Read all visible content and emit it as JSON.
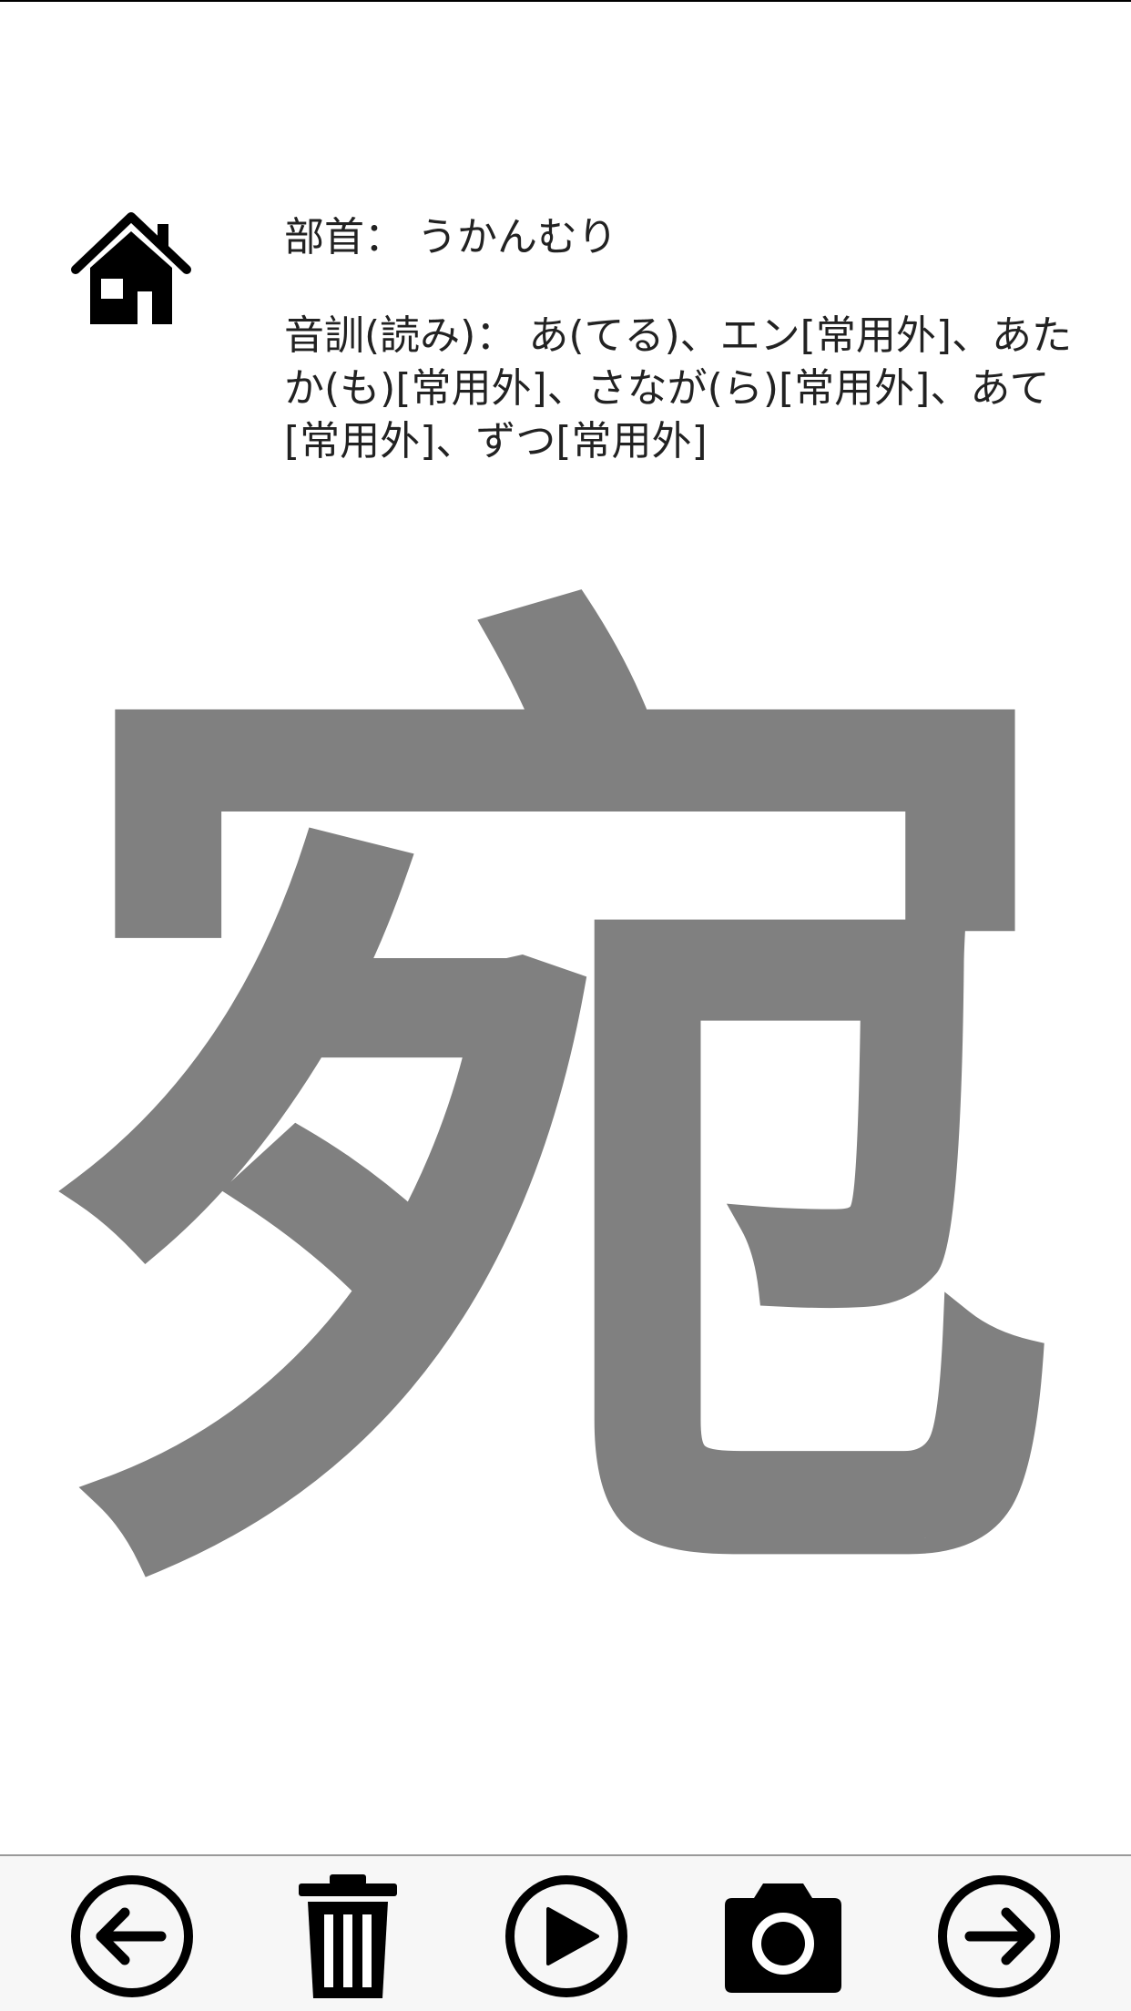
{
  "kanji": {
    "character": "宛",
    "color": "#808080"
  },
  "info": {
    "radical_label": "部首：",
    "radical_value": "うかんむり",
    "reading_label": "音訓(読み)：",
    "reading_value": "あ(てる)、エン[常用外]、あたか(も)[常用外]、さなが(ら)[常用外]、あて[常用外]、ずつ[常用外]"
  },
  "icons": {
    "home": "home-icon",
    "back": "arrow-left-circle-icon",
    "trash": "trash-icon",
    "play": "play-circle-icon",
    "camera": "camera-icon",
    "next": "arrow-right-circle-icon"
  },
  "colors": {
    "background": "#ffffff",
    "toolbar": "#f7f7f7",
    "text": "#222222",
    "icon": "#000000"
  }
}
